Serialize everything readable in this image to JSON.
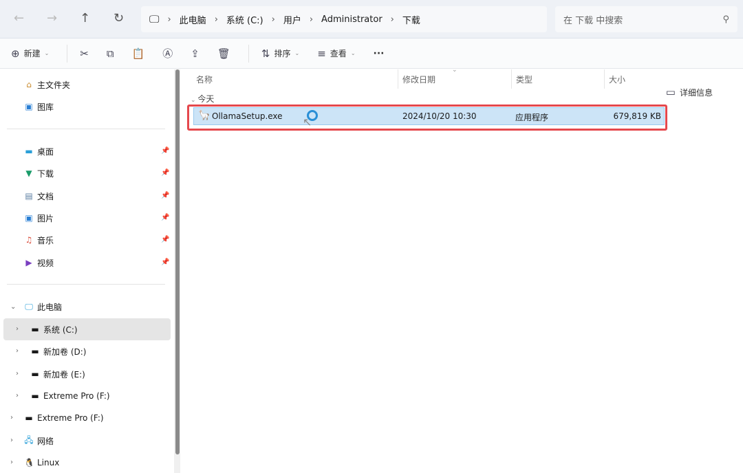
{
  "nav": {
    "back": "←",
    "forward": "→",
    "up": "↑",
    "refresh": "↻"
  },
  "address": {
    "segments": [
      "此电脑",
      "系统 (C:)",
      "用户",
      "Administrator",
      "下载"
    ],
    "separator": "›"
  },
  "search": {
    "placeholder": "在 下载 中搜索"
  },
  "toolbar": {
    "new": "新建",
    "sort": "排序",
    "view": "查看",
    "more": "···",
    "details": "详细信息"
  },
  "sidebar": {
    "quick": [
      {
        "label": "主文件夹",
        "icon": "home-icon"
      },
      {
        "label": "图库",
        "icon": "gallery-icon"
      }
    ],
    "pinned": [
      {
        "label": "桌面"
      },
      {
        "label": "下载"
      },
      {
        "label": "文档"
      },
      {
        "label": "图片"
      },
      {
        "label": "音乐"
      },
      {
        "label": "视频"
      }
    ],
    "this_pc": "此电脑",
    "drives": [
      "系统 (C:)",
      "新加卷 (D:)",
      "新加卷 (E:)",
      "Extreme Pro (F:)"
    ],
    "extra": [
      "Extreme Pro (F:)",
      "网络",
      "Linux"
    ]
  },
  "columns": {
    "name": "名称",
    "date": "修改日期",
    "type": "类型",
    "size": "大小"
  },
  "group": "今天",
  "files": [
    {
      "name": "OllamaSetup.exe",
      "date": "2024/10/20 10:30",
      "type": "应用程序",
      "size": "679,819 KB"
    }
  ],
  "colors": {
    "selection": "#cce4f7",
    "highlight": "#e5484d"
  }
}
